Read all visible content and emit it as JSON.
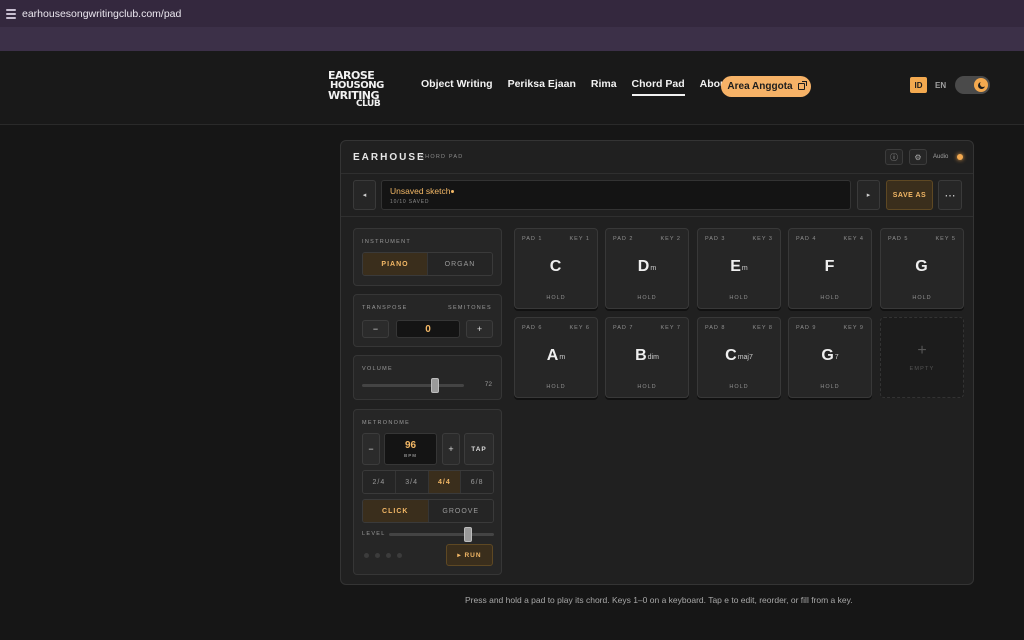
{
  "browser": {
    "url": "earhousesongwritingclub.com/pad"
  },
  "site": {
    "logo_lines": [
      "EAROSE",
      "HOUSONG",
      "WRITING",
      "CLUB"
    ],
    "nav": [
      {
        "label": "Object Writing",
        "active": false
      },
      {
        "label": "Periksa Ejaan",
        "active": false
      },
      {
        "label": "Rima",
        "active": false
      },
      {
        "label": "Chord Pad",
        "active": true
      },
      {
        "label": "About",
        "active": false
      }
    ],
    "member_button": "Area Anggota",
    "lang_active": "ID",
    "lang_other": "EN"
  },
  "header": {
    "brand": "EARHOUSE",
    "subtitle": "CHORD PAD",
    "audio_label": "Audio"
  },
  "sketch": {
    "prev": "◂",
    "title": "Unsaved sketch",
    "count": "10/10 SAVED",
    "next": "▸",
    "save_as": "SAVE AS",
    "more": "⋯"
  },
  "instrument": {
    "label": "INSTRUMENT",
    "options": [
      "PIANO",
      "ORGAN"
    ],
    "selected": "PIANO"
  },
  "transpose": {
    "label": "TRANSPOSE",
    "unit_label": "SEMITONES",
    "minus": "−",
    "value": "0",
    "plus": "+"
  },
  "volume": {
    "label": "VOLUME",
    "value": "72",
    "level": 0.72
  },
  "metronome": {
    "label": "METRONOME",
    "minus": "−",
    "bpm": "96",
    "bpm_unit": "BPM",
    "plus": "+",
    "tap": "TAP",
    "signatures": [
      "2/4",
      "3/4",
      "4/4",
      "6/8"
    ],
    "selected_signature": "4/4",
    "modes": [
      "CLICK",
      "GROOVE"
    ],
    "selected_mode": "CLICK",
    "level_label": "LEVEL",
    "level": 0.75,
    "run": "▸ RUN"
  },
  "pads": [
    {
      "num": "PAD 1",
      "key": "KEY 1",
      "root": "C",
      "quality": "",
      "hold": "HOLD"
    },
    {
      "num": "PAD 2",
      "key": "KEY 2",
      "root": "D",
      "quality": "m",
      "hold": "HOLD"
    },
    {
      "num": "PAD 3",
      "key": "KEY 3",
      "root": "E",
      "quality": "m",
      "hold": "HOLD"
    },
    {
      "num": "PAD 4",
      "key": "KEY 4",
      "root": "F",
      "quality": "",
      "hold": "HOLD"
    },
    {
      "num": "PAD 5",
      "key": "KEY 5",
      "root": "G",
      "quality": "",
      "hold": "HOLD"
    },
    {
      "num": "PAD 6",
      "key": "KEY 6",
      "root": "A",
      "quality": "m",
      "hold": "HOLD"
    },
    {
      "num": "PAD 7",
      "key": "KEY 7",
      "root": "B",
      "quality": "dim",
      "hold": "HOLD"
    },
    {
      "num": "PAD 8",
      "key": "KEY 8",
      "root": "C",
      "quality": "maj7",
      "hold": "HOLD"
    },
    {
      "num": "PAD 9",
      "key": "KEY 9",
      "root": "G",
      "quality": "7",
      "hold": "HOLD"
    }
  ],
  "empty_pad": {
    "plus": "+",
    "label": "EMPTY"
  },
  "hint": "Press and hold a pad to play its chord. Keys 1–0 on a keyboard. Tap e to edit, reorder, or fill from a key.",
  "colors": {
    "accent": "#f3b866",
    "member_button": "#f6b267",
    "background": "#161616"
  }
}
